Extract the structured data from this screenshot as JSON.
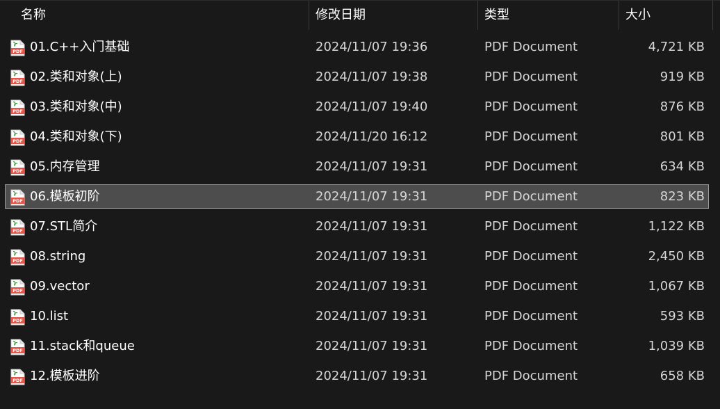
{
  "columns": {
    "name": "名称",
    "date": "修改日期",
    "type": "类型",
    "size": "大小"
  },
  "sort_indicator": "^",
  "icon": "pdf-file-icon",
  "files": [
    {
      "name": "01.C++入门基础",
      "date": "2024/11/07 19:36",
      "type": "PDF Document",
      "size": "4,721 KB"
    },
    {
      "name": "02.类和对象(上)",
      "date": "2024/11/07 19:38",
      "type": "PDF Document",
      "size": "919 KB"
    },
    {
      "name": "03.类和对象(中)",
      "date": "2024/11/07 19:40",
      "type": "PDF Document",
      "size": "876 KB"
    },
    {
      "name": "04.类和对象(下)",
      "date": "2024/11/20 16:12",
      "type": "PDF Document",
      "size": "801 KB"
    },
    {
      "name": "05.内存管理",
      "date": "2024/11/07 19:31",
      "type": "PDF Document",
      "size": "634 KB"
    },
    {
      "name": "06.模板初阶",
      "date": "2024/11/07 19:31",
      "type": "PDF Document",
      "size": "823 KB",
      "selected": true
    },
    {
      "name": "07.STL简介",
      "date": "2024/11/07 19:31",
      "type": "PDF Document",
      "size": "1,122 KB"
    },
    {
      "name": "08.string",
      "date": "2024/11/07 19:31",
      "type": "PDF Document",
      "size": "2,450 KB"
    },
    {
      "name": "09.vector",
      "date": "2024/11/07 19:31",
      "type": "PDF Document",
      "size": "1,067 KB"
    },
    {
      "name": "10.list",
      "date": "2024/11/07 19:31",
      "type": "PDF Document",
      "size": "593 KB"
    },
    {
      "name": "11.stack和queue",
      "date": "2024/11/07 19:31",
      "type": "PDF Document",
      "size": "1,039 KB"
    },
    {
      "name": "12.模板进阶",
      "date": "2024/11/07 19:31",
      "type": "PDF Document",
      "size": "658 KB"
    }
  ],
  "colors": {
    "background": "#191919",
    "selected_row": "#4d4d4d",
    "pdf_icon": "#e2574c"
  }
}
